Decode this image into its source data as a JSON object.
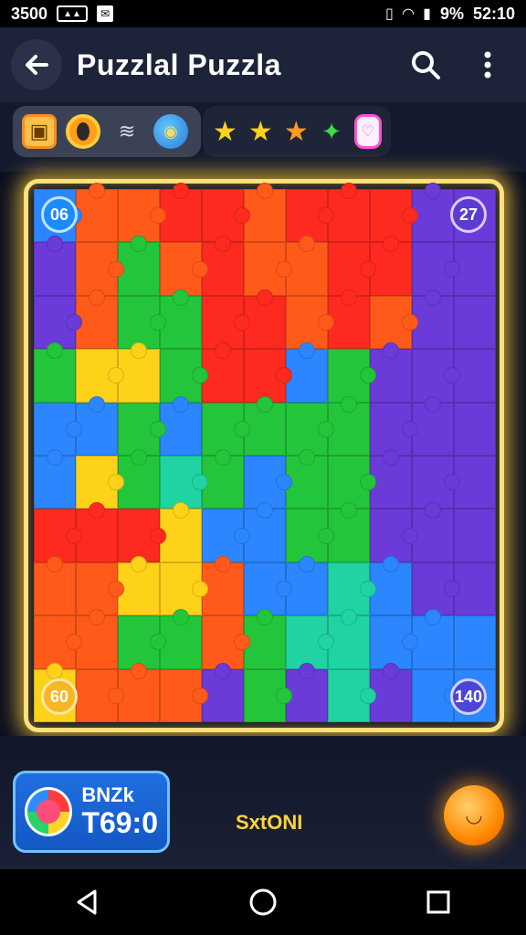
{
  "status_bar": {
    "left_text": "3500",
    "right_text": "52:10",
    "battery_text": "9%"
  },
  "header": {
    "title": "Puzzlal Puzzla"
  },
  "toolbar": {
    "left_tools": [
      "frame-icon",
      "ring-icon",
      "wave-icon",
      "globe-icon"
    ],
    "right_tools": [
      "star-icon",
      "star-icon",
      "star-icon",
      "multicolor-piece-icon",
      "tag-icon"
    ]
  },
  "board": {
    "corner_top_left": "06",
    "corner_top_right": "27",
    "corner_bottom_left": "60",
    "corner_bottom_right": "140",
    "colors": {
      "R": "#ff2a1f",
      "O": "#ff5a1a",
      "G": "#23c63a",
      "Y": "#ffd21a",
      "B": "#2b86ff",
      "P": "#6a3bd8",
      "T": "#20d3a3"
    },
    "pieces": [
      [
        "B",
        "O",
        "O",
        "R",
        "R",
        "O",
        "R",
        "R",
        "R",
        "P",
        "P"
      ],
      [
        "P",
        "O",
        "G",
        "O",
        "R",
        "O",
        "O",
        "R",
        "R",
        "P",
        "P"
      ],
      [
        "P",
        "O",
        "G",
        "G",
        "R",
        "R",
        "O",
        "R",
        "O",
        "P",
        "P"
      ],
      [
        "G",
        "Y",
        "Y",
        "G",
        "R",
        "R",
        "B",
        "G",
        "P",
        "P",
        "P"
      ],
      [
        "B",
        "B",
        "G",
        "B",
        "G",
        "G",
        "G",
        "G",
        "P",
        "P",
        "P"
      ],
      [
        "B",
        "Y",
        "G",
        "T",
        "G",
        "B",
        "G",
        "G",
        "P",
        "P",
        "P"
      ],
      [
        "R",
        "R",
        "R",
        "Y",
        "B",
        "B",
        "G",
        "G",
        "P",
        "P",
        "P"
      ],
      [
        "O",
        "O",
        "Y",
        "Y",
        "O",
        "B",
        "B",
        "T",
        "B",
        "P",
        "P"
      ],
      [
        "O",
        "O",
        "G",
        "G",
        "O",
        "G",
        "T",
        "T",
        "B",
        "B",
        "B"
      ],
      [
        "Y",
        "O",
        "O",
        "O",
        "P",
        "G",
        "P",
        "T",
        "P",
        "B",
        "B"
      ]
    ]
  },
  "bottom": {
    "score_label": "BNZk",
    "score_value": "T69:0",
    "status": "SxtONI"
  }
}
